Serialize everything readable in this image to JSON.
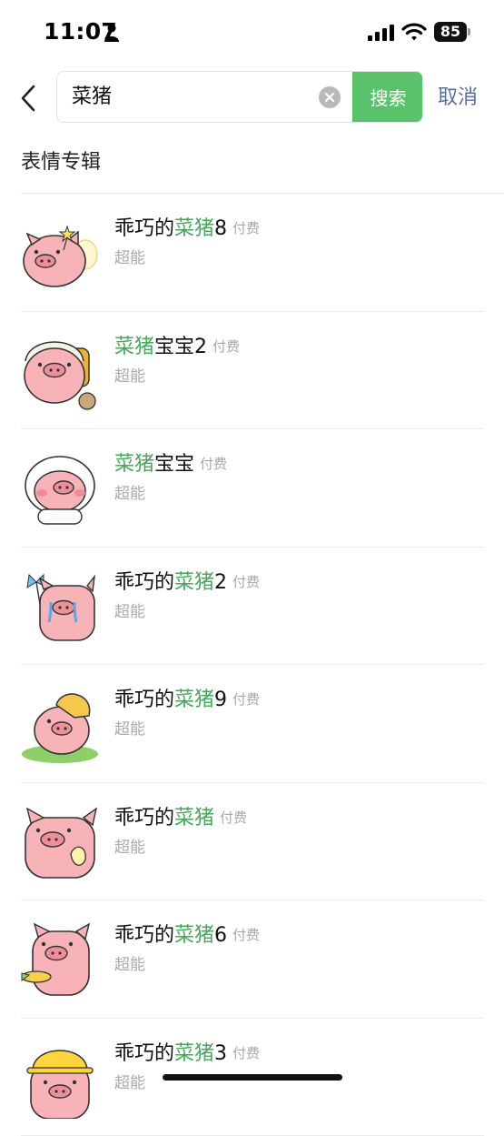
{
  "status_bar": {
    "time": "11:07",
    "battery": "85",
    "icons": [
      "person-icon",
      "signal-icon",
      "wifi-icon",
      "battery-icon"
    ]
  },
  "header": {
    "back_icon": "chevron-left-icon",
    "search_value": "菜猪",
    "clear_icon": "clear-icon",
    "search_button": "搜索",
    "cancel": "取消"
  },
  "section": {
    "title": "表情专辑"
  },
  "colors": {
    "accent": "#5ac26a",
    "highlight_text": "#46a85a",
    "link": "#58709b",
    "pig_pink": "#f7b3b8"
  },
  "results": [
    {
      "pre": "乖巧的",
      "hl": "菜猪",
      "post": "8",
      "tag": "付费",
      "author": "超能",
      "thumb": "pig-fairy-sticker"
    },
    {
      "pre": "",
      "hl": "菜猪",
      "post": "宝宝2",
      "tag": "付费",
      "author": "超能",
      "thumb": "pig-backpack-sticker"
    },
    {
      "pre": "",
      "hl": "菜猪",
      "post": "宝宝",
      "tag": "付费",
      "author": "超能",
      "thumb": "pig-baby-sticker"
    },
    {
      "pre": "乖巧的",
      "hl": "菜猪",
      "post": "2",
      "tag": "付费",
      "author": "超能",
      "thumb": "pig-crying-sticker"
    },
    {
      "pre": "乖巧的",
      "hl": "菜猪",
      "post": "9",
      "tag": "付费",
      "author": "超能",
      "thumb": "pig-straw-hat-sticker"
    },
    {
      "pre": "乖巧的",
      "hl": "菜猪",
      "post": "",
      "tag": "付费",
      "author": "超能",
      "thumb": "pig-banana-sticker"
    },
    {
      "pre": "乖巧的",
      "hl": "菜猪",
      "post": "6",
      "tag": "付费",
      "author": "超能",
      "thumb": "pig-corn-sticker"
    },
    {
      "pre": "乖巧的",
      "hl": "菜猪",
      "post": "3",
      "tag": "付费",
      "author": "超能",
      "thumb": "pig-hardhat-sticker"
    }
  ]
}
